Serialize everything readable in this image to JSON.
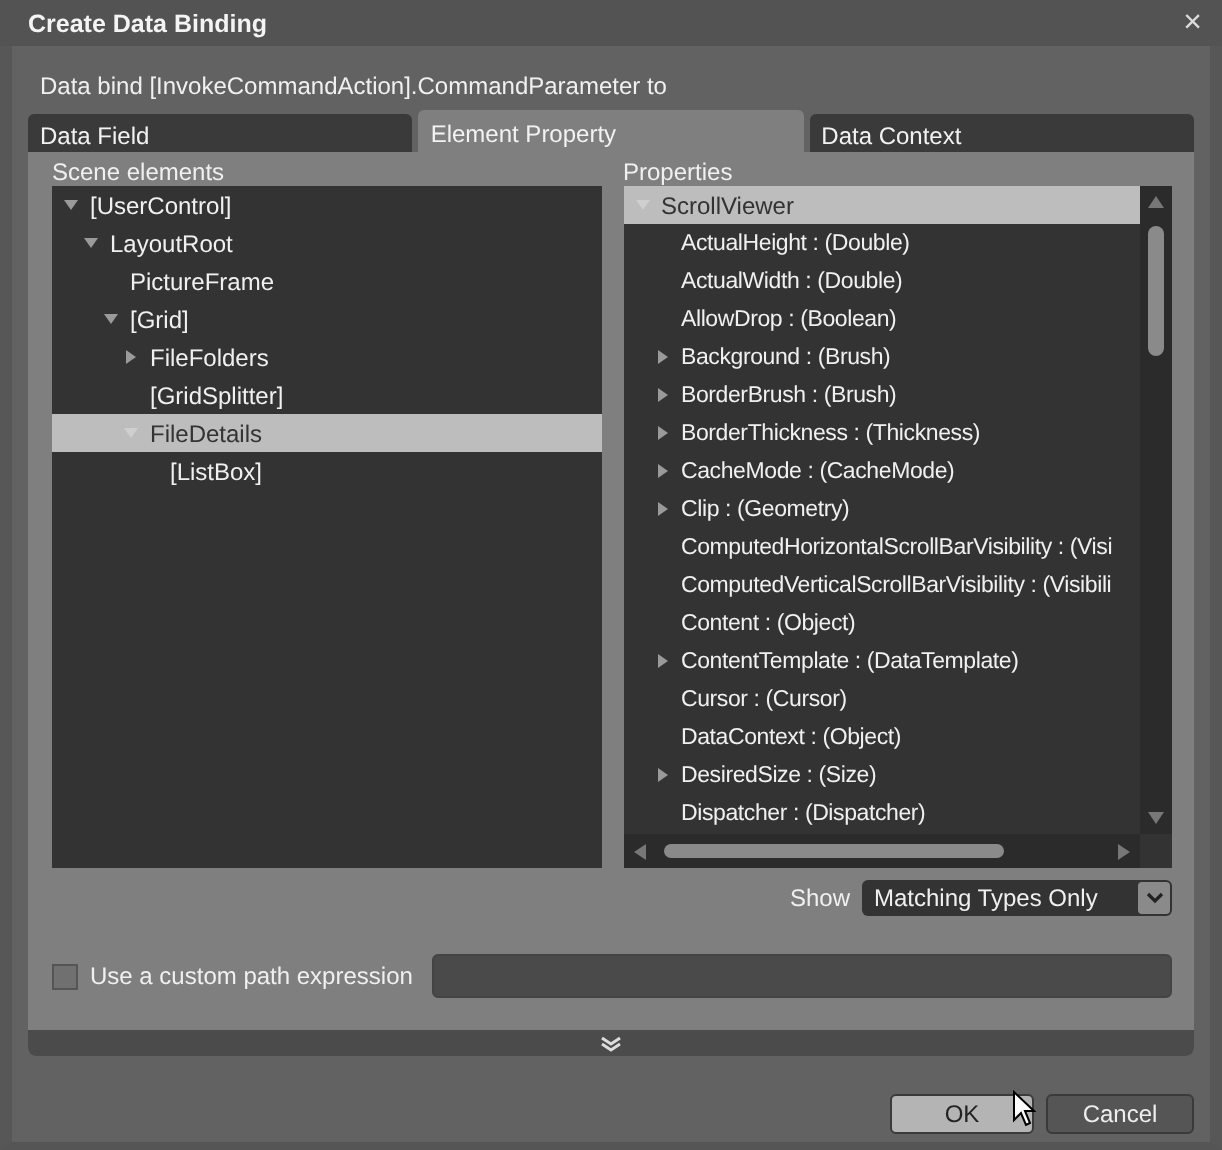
{
  "window": {
    "title": "Create Data Binding",
    "close": "×"
  },
  "prompt": "Data bind [InvokeCommandAction].CommandParameter to",
  "tabs": [
    {
      "label": "Data Field",
      "selected": false
    },
    {
      "label": "Element Property",
      "selected": true
    },
    {
      "label": "Data Context",
      "selected": false
    }
  ],
  "scene_elements": {
    "label": "Scene elements",
    "tree": [
      {
        "label": "[UserControl]",
        "expanded": true,
        "selected": false,
        "children": [
          {
            "label": "LayoutRoot",
            "expanded": true,
            "selected": false,
            "children": [
              {
                "label": "PictureFrame",
                "selected": false
              },
              {
                "label": "[Grid]",
                "expanded": true,
                "selected": false,
                "children": [
                  {
                    "label": "FileFolders",
                    "expanded": false,
                    "selected": false
                  },
                  {
                    "label": "[GridSplitter]",
                    "selected": false
                  },
                  {
                    "label": "FileDetails",
                    "expanded": true,
                    "selected": true,
                    "children": [
                      {
                        "label": "[ListBox]",
                        "selected": false
                      }
                    ]
                  }
                ]
              }
            ]
          }
        ]
      }
    ]
  },
  "properties": {
    "label": "Properties",
    "group": {
      "label": "ScrollViewer",
      "expanded": true,
      "selected": true
    },
    "items": [
      {
        "label": "ActualHeight : (Double)"
      },
      {
        "label": "ActualWidth : (Double)"
      },
      {
        "label": "AllowDrop : (Boolean)"
      },
      {
        "label": "Background : (Brush)",
        "expanded": false
      },
      {
        "label": "BorderBrush : (Brush)",
        "expanded": false
      },
      {
        "label": "BorderThickness : (Thickness)",
        "expanded": false
      },
      {
        "label": "CacheMode : (CacheMode)",
        "expanded": false
      },
      {
        "label": "Clip : (Geometry)",
        "expanded": false
      },
      {
        "label": "ComputedHorizontalScrollBarVisibility : (Visi"
      },
      {
        "label": "ComputedVerticalScrollBarVisibility : (Visibili"
      },
      {
        "label": "Content : (Object)"
      },
      {
        "label": "ContentTemplate : (DataTemplate)",
        "expanded": false
      },
      {
        "label": "Cursor : (Cursor)"
      },
      {
        "label": "DataContext : (Object)"
      },
      {
        "label": "DesiredSize : (Size)",
        "expanded": false
      },
      {
        "label": "Dispatcher : (Dispatcher)"
      }
    ]
  },
  "show": {
    "label": "Show",
    "value": "Matching Types Only"
  },
  "custom_path": {
    "label": "Use a custom path expression",
    "checked": false
  },
  "buttons": [
    {
      "label": "OK",
      "hovered": true
    },
    {
      "label": "Cancel",
      "hovered": false
    }
  ]
}
